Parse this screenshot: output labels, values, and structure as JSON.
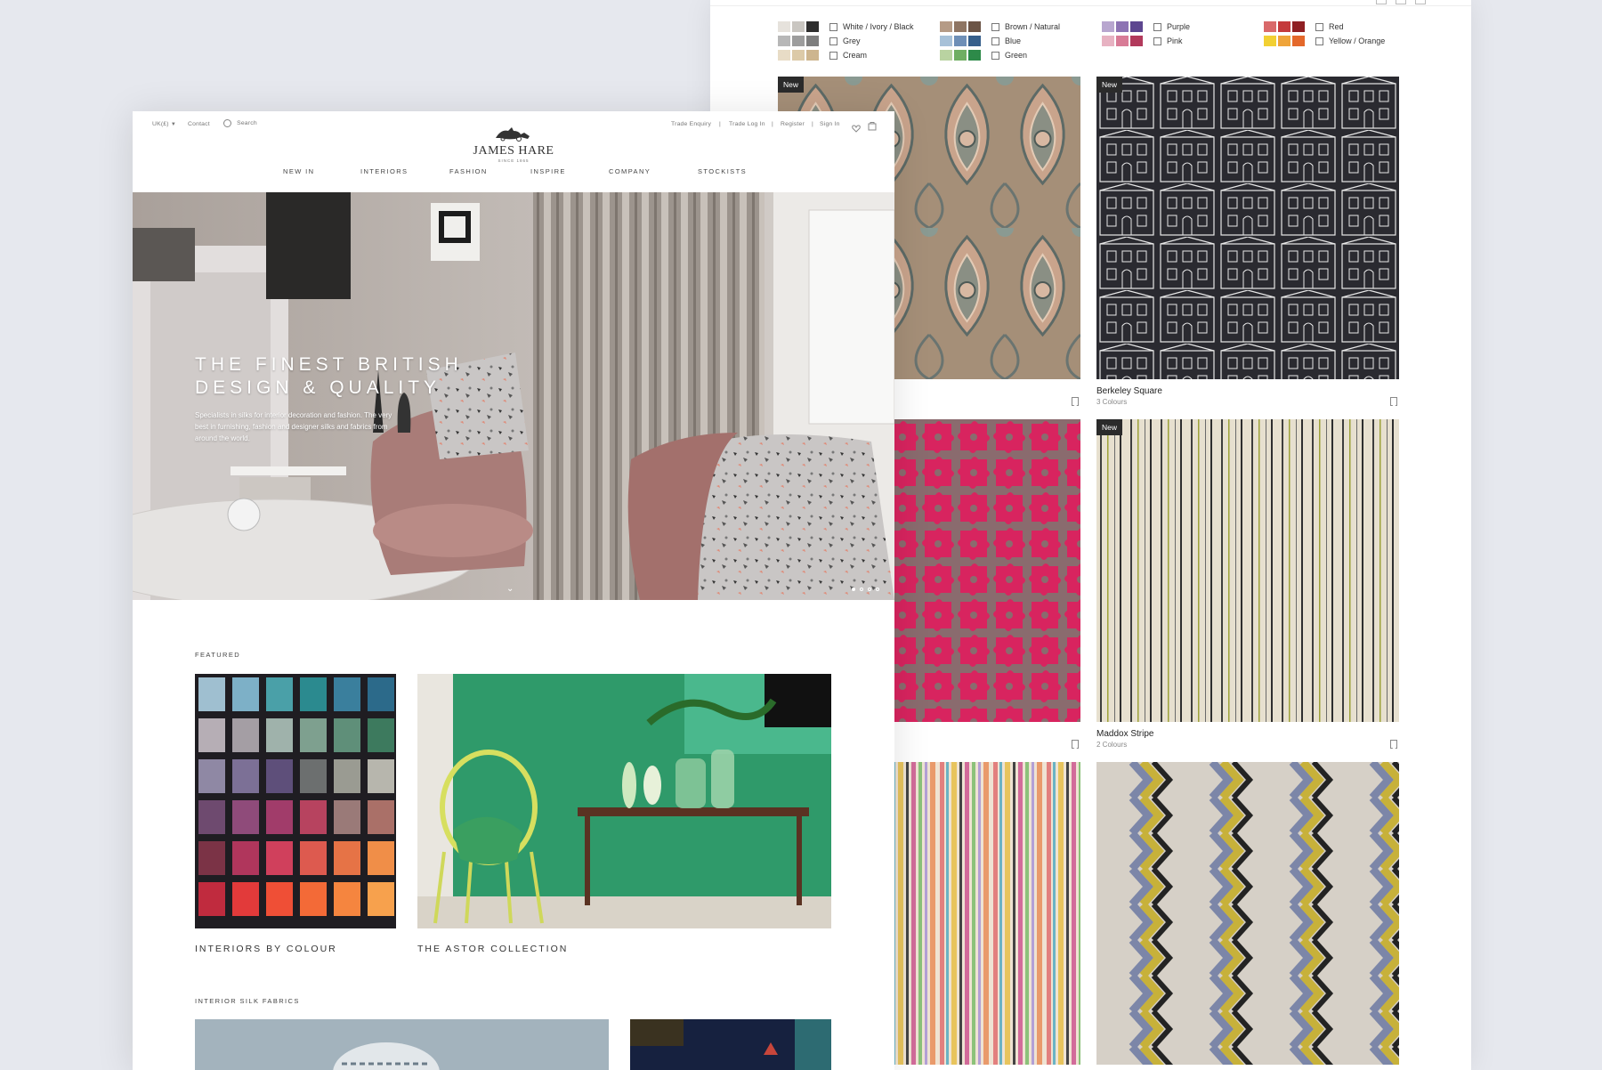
{
  "catalogue": {
    "filters": [
      {
        "label": "White / Ivory / Black",
        "swatches": [
          "#e6e2dc",
          "#c9c6c1",
          "#2e2e2e"
        ]
      },
      {
        "label": "Grey",
        "swatches": [
          "#b7b7b7",
          "#9d9d9d",
          "#7e7e7e"
        ]
      },
      {
        "label": "Cream",
        "swatches": [
          "#e8dcc6",
          "#dccaa8",
          "#cdb58e"
        ]
      },
      {
        "label": "Brown / Natural",
        "swatches": [
          "#b59b86",
          "#8e7563",
          "#6b5446"
        ]
      },
      {
        "label": "Blue",
        "swatches": [
          "#a7c1d8",
          "#6e8fb7",
          "#365f8b"
        ]
      },
      {
        "label": "Green",
        "swatches": [
          "#b9d3a1",
          "#6fae62",
          "#2d8a49"
        ]
      },
      {
        "label": "Purple",
        "swatches": [
          "#b8a6cf",
          "#8d73b3",
          "#5d4690"
        ]
      },
      {
        "label": "Pink",
        "swatches": [
          "#e7b2c2",
          "#d87b96",
          "#b23a5c"
        ]
      },
      {
        "label": "Red",
        "swatches": [
          "#d9696a",
          "#c43a3c",
          "#8f1f23"
        ]
      },
      {
        "label": "Yellow / Orange",
        "swatches": [
          "#f2d033",
          "#efa43a",
          "#e4682a"
        ]
      }
    ],
    "products": [
      {
        "badge": "New",
        "name": "",
        "colours": ""
      },
      {
        "badge": "New",
        "name": "Berkeley Square",
        "colours": "3 Colours"
      },
      {
        "badge": "",
        "name": "",
        "colours": ""
      },
      {
        "badge": "New",
        "name": "Maddox Stripe",
        "colours": "2 Colours"
      },
      {
        "badge": "",
        "name": "",
        "colours": ""
      },
      {
        "badge": "",
        "name": "",
        "colours": ""
      }
    ]
  },
  "home": {
    "header": {
      "currency": "UK(£)",
      "contact": "Contact",
      "search": "Search",
      "trade_enquiry": "Trade Enquiry",
      "trade_login": "Trade Log In",
      "register": "Register",
      "sign_in": "Sign In",
      "separator": "|",
      "logo_name": "JAMES HARE",
      "logo_since": "SINCE 1865"
    },
    "nav": [
      "NEW IN",
      "INTERIORS",
      "FASHION",
      "INSPIRE",
      "COMPANY",
      "STOCKISTS"
    ],
    "hero": {
      "title_line1": "THE FINEST BRITISH",
      "title_line2": "DESIGN & QUALITY",
      "subtitle": "Specialists in silks for interior decoration and fashion. The very best in furnishing, fashion and designer silks and fabrics from around the world."
    },
    "featured_label": "FEATURED",
    "featured": [
      {
        "caption": "INTERIORS BY COLOUR"
      },
      {
        "caption": "THE ASTOR COLLECTION"
      }
    ],
    "silk_label": "INTERIOR SILK FABRICS"
  }
}
